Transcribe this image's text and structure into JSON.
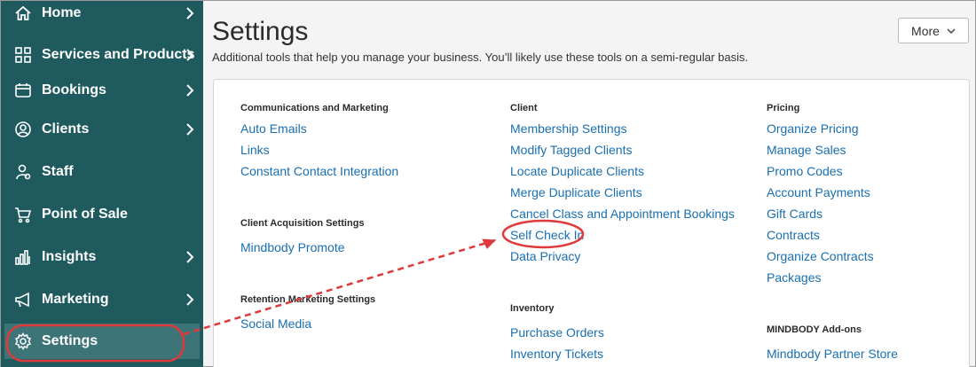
{
  "sidebar": {
    "items": [
      {
        "label": "Home",
        "icon": "home-icon",
        "chevron": true
      },
      {
        "label": "Services and Products",
        "icon": "grid-icon",
        "chevron": true
      },
      {
        "label": "Bookings",
        "icon": "calendar-icon",
        "chevron": true
      },
      {
        "label": "Clients",
        "icon": "user-circle-icon",
        "chevron": true
      },
      {
        "label": "Staff",
        "icon": "staff-icon",
        "chevron": false
      },
      {
        "label": "Point of Sale",
        "icon": "cart-icon",
        "chevron": false
      },
      {
        "label": "Insights",
        "icon": "bar-chart-icon",
        "chevron": true
      },
      {
        "label": "Marketing",
        "icon": "megaphone-icon",
        "chevron": true
      },
      {
        "label": "Settings",
        "icon": "gear-icon",
        "chevron": false,
        "active": true
      }
    ]
  },
  "header": {
    "title": "Settings",
    "subtitle": "Additional tools that help you manage your business. You’ll likely use these tools on a semi-regular basis.",
    "more_label": "More"
  },
  "sections": {
    "comm": {
      "title": "Communications and Marketing",
      "links": [
        "Auto Emails",
        "Links",
        "Constant Contact Integration"
      ]
    },
    "acq": {
      "title": "Client Acquisition Settings",
      "links": [
        "Mindbody Promote"
      ]
    },
    "retention": {
      "title": "Retention Marketing Settings",
      "links": [
        "Social Media"
      ]
    },
    "client": {
      "title": "Client",
      "links": [
        "Membership Settings",
        "Modify Tagged Clients",
        "Locate Duplicate Clients",
        "Merge Duplicate Clients",
        "Cancel Class and Appointment Bookings",
        "Self Check In",
        "Data Privacy"
      ]
    },
    "inventory": {
      "title": "Inventory",
      "links": [
        "Purchase Orders",
        "Inventory Tickets"
      ]
    },
    "pricing": {
      "title": "Pricing",
      "links": [
        "Organize Pricing",
        "Manage Sales",
        "Promo Codes",
        "Account Payments",
        "Gift Cards",
        "Contracts",
        "Organize Contracts",
        "Packages"
      ]
    },
    "addons": {
      "title": "MINDBODY Add-ons",
      "links": [
        "Mindbody Partner Store"
      ]
    }
  },
  "colors": {
    "sidebar_bg": "#1f5a5e",
    "sidebar_active": "#3d7477",
    "link": "#1a6fb0",
    "annotation": "#e0393b"
  }
}
